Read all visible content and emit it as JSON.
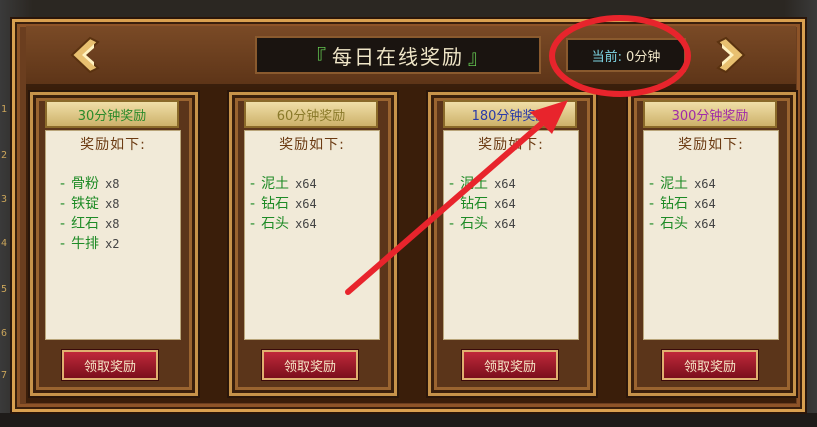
{
  "window": {
    "title": "每日在线奖励",
    "title_bracket_left": "『",
    "title_bracket_right": "』"
  },
  "status": {
    "current_label": "当前:",
    "current_value": "0分钟"
  },
  "side_markers": [
    "1",
    "2",
    "3",
    "4",
    "5",
    "6",
    "7"
  ],
  "cards": [
    {
      "tab_label": "30分钟奖励",
      "tab_color": "#2a8a2a",
      "panel_title": "奖励如下:",
      "rewards": [
        {
          "dash": "-",
          "name": "骨粉",
          "qty": "x8"
        },
        {
          "dash": "-",
          "name": "铁锭",
          "qty": "x8"
        },
        {
          "dash": "-",
          "name": "红石",
          "qty": "x8"
        },
        {
          "dash": "-",
          "name": "牛排",
          "qty": "x2"
        }
      ],
      "button_label": "领取奖励"
    },
    {
      "tab_label": "60分钟奖励",
      "tab_color": "#8a7a2a",
      "panel_title": "奖励如下:",
      "rewards": [
        {
          "dash": "-",
          "name": "泥土",
          "qty": "x64"
        },
        {
          "dash": "-",
          "name": "钻石",
          "qty": "x64"
        },
        {
          "dash": "-",
          "name": "石头",
          "qty": "x64"
        }
      ],
      "button_label": "领取奖励"
    },
    {
      "tab_label": "180分钟奖励",
      "tab_color": "#2a3aa8",
      "panel_title": "奖励如下:",
      "rewards": [
        {
          "dash": "-",
          "name": "泥土",
          "qty": "x64"
        },
        {
          "dash": "-",
          "name": "钻石",
          "qty": "x64"
        },
        {
          "dash": "-",
          "name": "石头",
          "qty": "x64"
        }
      ],
      "button_label": "领取奖励"
    },
    {
      "tab_label": "300分钟奖励",
      "tab_color": "#a02aa8",
      "panel_title": "奖励如下:",
      "rewards": [
        {
          "dash": "-",
          "name": "泥土",
          "qty": "x64"
        },
        {
          "dash": "-",
          "name": "钻石",
          "qty": "x64"
        },
        {
          "dash": "-",
          "name": "石头",
          "qty": "x64"
        }
      ],
      "button_label": "领取奖励"
    }
  ],
  "colors": {
    "frame_gold": "#d9a050",
    "wood": "#6b3e1f",
    "reward_text": "#1e8b26",
    "button_red": "#a01a2a",
    "annotation_red": "#e8242c"
  },
  "icons": {
    "prev": "chevron-left-icon",
    "next": "chevron-right-icon"
  }
}
